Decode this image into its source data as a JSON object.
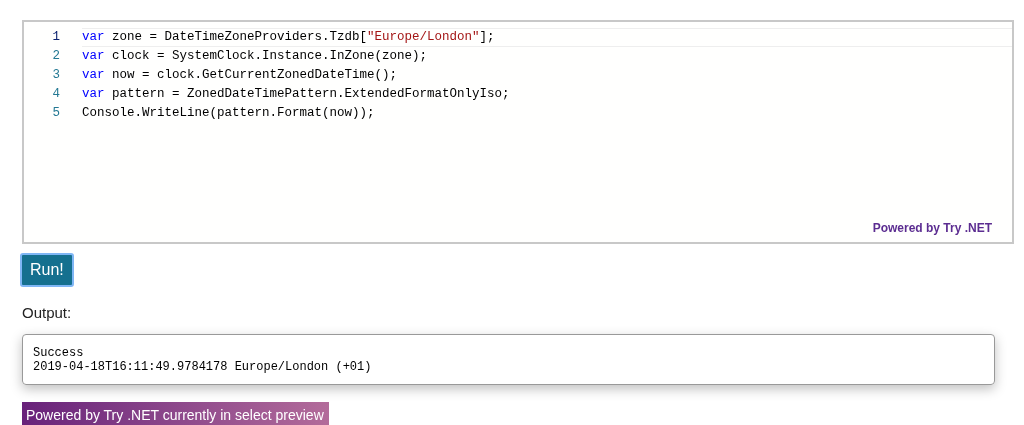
{
  "editor": {
    "lines": [
      {
        "number": "1",
        "current": true,
        "tokens": [
          {
            "kind": "keyword",
            "text": "var"
          },
          {
            "kind": "plain",
            "text": " zone = DateTimeZoneProviders.Tzdb["
          },
          {
            "kind": "string",
            "text": "\"Europe/London\""
          },
          {
            "kind": "plain",
            "text": "];"
          }
        ]
      },
      {
        "number": "2",
        "current": false,
        "tokens": [
          {
            "kind": "keyword",
            "text": "var"
          },
          {
            "kind": "plain",
            "text": " clock = SystemClock.Instance.InZone(zone);"
          }
        ]
      },
      {
        "number": "3",
        "current": false,
        "tokens": [
          {
            "kind": "keyword",
            "text": "var"
          },
          {
            "kind": "plain",
            "text": " now = clock.GetCurrentZonedDateTime();"
          }
        ]
      },
      {
        "number": "4",
        "current": false,
        "tokens": [
          {
            "kind": "keyword",
            "text": "var"
          },
          {
            "kind": "plain",
            "text": " pattern = ZonedDateTimePattern.ExtendedFormatOnlyIso;"
          }
        ]
      },
      {
        "number": "5",
        "current": false,
        "tokens": [
          {
            "kind": "plain",
            "text": "Console.WriteLine(pattern.Format(now));"
          }
        ]
      }
    ],
    "powered_by": "Powered by Try .NET"
  },
  "run_button": "Run!",
  "output_label": "Output:",
  "output_lines": [
    "Success",
    "2019-04-18T16:11:49.9784178 Europe/London (+01)"
  ],
  "banner": "Powered by Try .NET currently in select preview"
}
